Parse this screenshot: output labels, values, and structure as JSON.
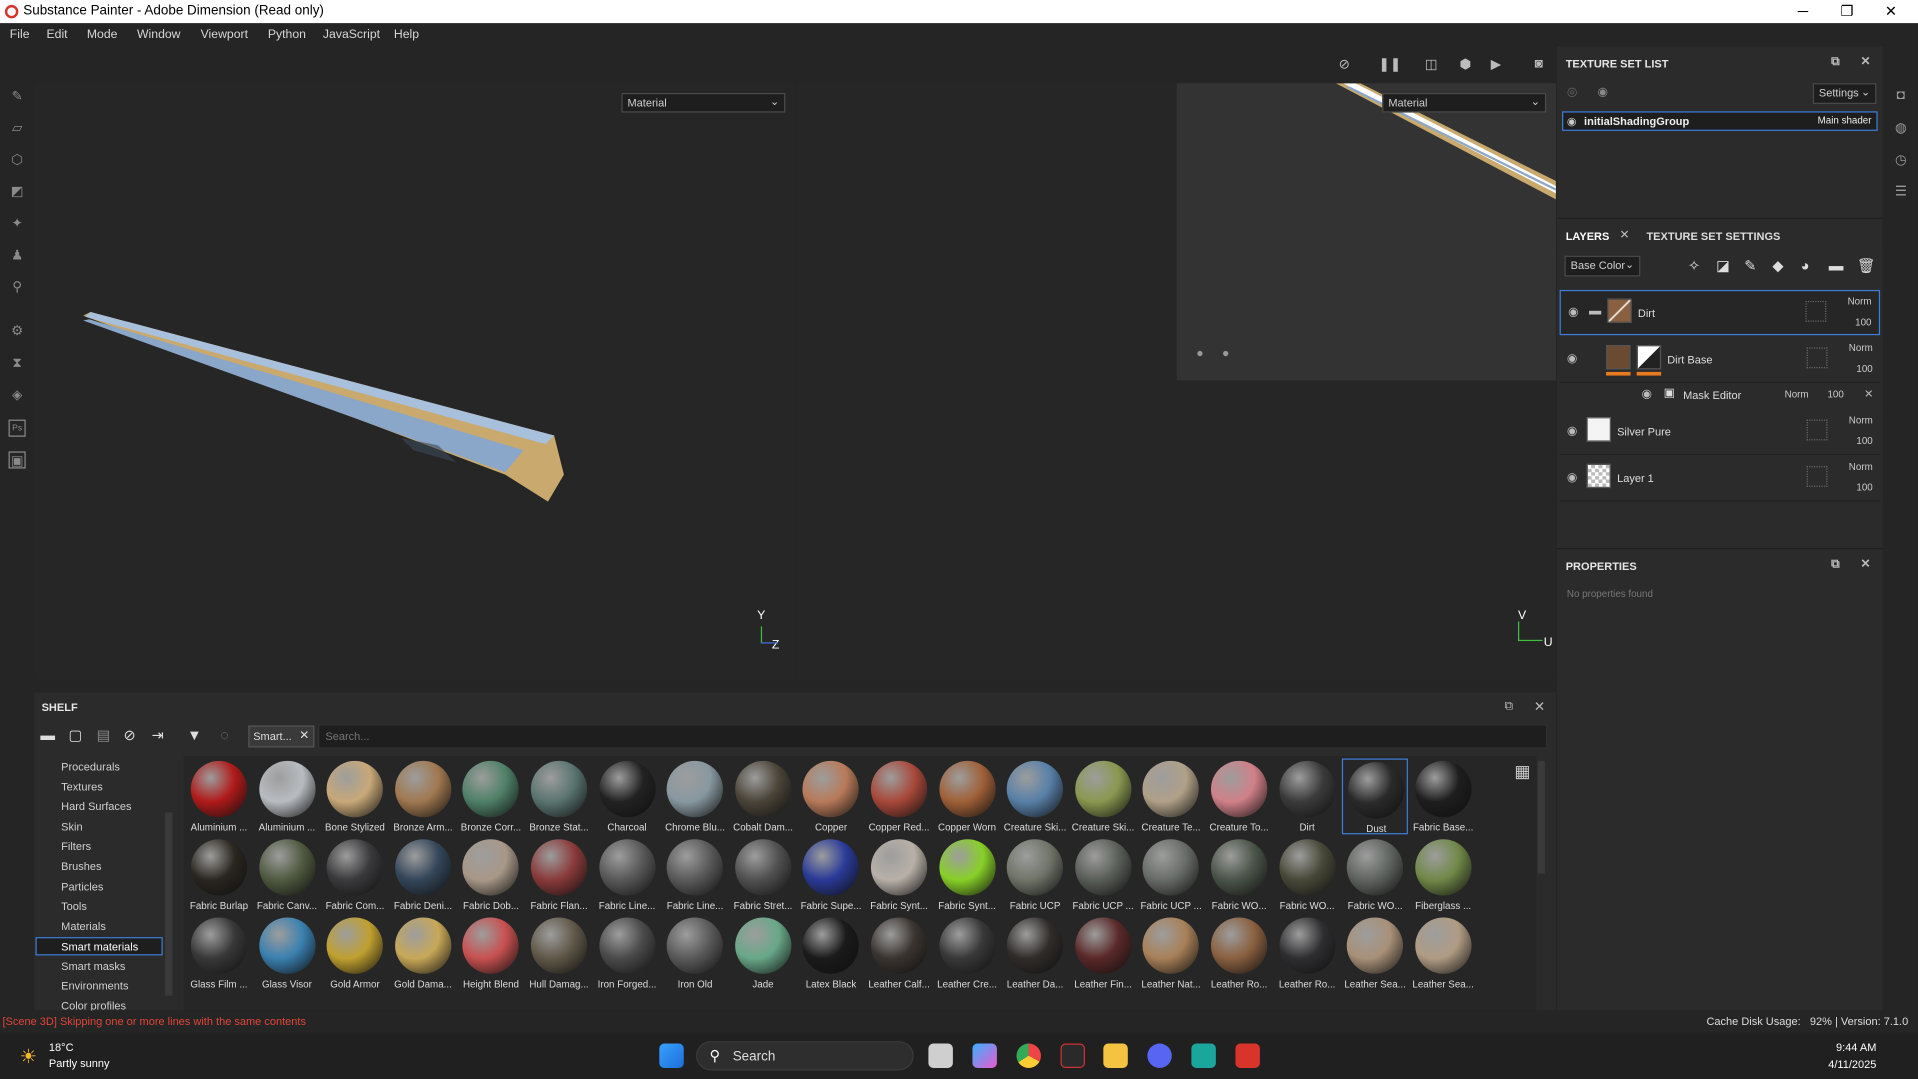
{
  "window": {
    "title": "Substance Painter - Adobe Dimension (Read only)",
    "minimize": "─",
    "maximize": "❐",
    "close": "✕"
  },
  "menu": [
    "File",
    "Edit",
    "Mode",
    "Window",
    "Viewport",
    "Python",
    "JavaScript",
    "Help"
  ],
  "viewport": {
    "left_dropdown": "Material",
    "right_dropdown": "Material",
    "axis_y": "Y",
    "axis_z": "Z",
    "axis_v": "V",
    "axis_u": "U"
  },
  "texture_set_list": {
    "title": "TEXTURE SET LIST",
    "settings_label": "Settings",
    "set_name": "initialShadingGroup",
    "shader": "Main shader"
  },
  "layers_panel": {
    "tab_layers": "LAYERS",
    "tab_tss": "TEXTURE SET SETTINGS",
    "channel": "Base Color",
    "layers": [
      {
        "name": "Dirt",
        "blend": "Norm",
        "opacity": "100"
      },
      {
        "name": "Dirt Base",
        "blend": "Norm",
        "opacity": "100"
      },
      {
        "name": "Mask Editor",
        "blend": "Norm",
        "opacity": "100"
      },
      {
        "name": "Silver Pure",
        "blend": "Norm",
        "opacity": "100"
      },
      {
        "name": "Layer 1",
        "blend": "Norm",
        "opacity": "100"
      }
    ]
  },
  "properties": {
    "title": "PROPERTIES",
    "empty": "No properties found"
  },
  "shelf": {
    "title": "SHELF",
    "filter_chip": "Smart...",
    "search_placeholder": "Search...",
    "categories": [
      "Procedurals",
      "Textures",
      "Hard Surfaces",
      "Skin",
      "Filters",
      "Brushes",
      "Particles",
      "Tools",
      "Materials",
      "Smart materials",
      "Smart masks",
      "Environments",
      "Color profiles"
    ],
    "selected_category": "Smart materials",
    "materials": [
      {
        "label": "Aluminium ...",
        "color": "#b01a1a"
      },
      {
        "label": "Aluminium ...",
        "color": "#b8bcc0"
      },
      {
        "label": "Bone Stylized",
        "color": "#c8a878"
      },
      {
        "label": "Bronze Arm...",
        "color": "#a07850"
      },
      {
        "label": "Bronze Corr...",
        "color": "#4f8068"
      },
      {
        "label": "Bronze Stat...",
        "color": "#5a7470"
      },
      {
        "label": "Charcoal",
        "color": "#222222"
      },
      {
        "label": "Chrome Blu...",
        "color": "#8898a0"
      },
      {
        "label": "Cobalt Dam...",
        "color": "#4a4438"
      },
      {
        "label": "Copper",
        "color": "#b87a5a"
      },
      {
        "label": "Copper Red...",
        "color": "#a8483a"
      },
      {
        "label": "Copper Worn",
        "color": "#a06038"
      },
      {
        "label": "Creature Ski...",
        "color": "#5880a8"
      },
      {
        "label": "Creature Ski...",
        "color": "#8a9850"
      },
      {
        "label": "Creature Te...",
        "color": "#b0a088"
      },
      {
        "label": "Creature To...",
        "color": "#d08088"
      },
      {
        "label": "Dirt",
        "color": "#3a3a3a"
      },
      {
        "label": "Dust",
        "color": "#2a2a2a"
      },
      {
        "label": "Fabric Base...",
        "color": "#1e1e1e"
      },
      {
        "label": "Fabric Burlap",
        "color": "#2a2620"
      },
      {
        "label": "Fabric Canv...",
        "color": "#505a40"
      },
      {
        "label": "Fabric Com...",
        "color": "#3a3a3c"
      },
      {
        "label": "Fabric Deni...",
        "color": "#34465a"
      },
      {
        "label": "Fabric Dob...",
        "color": "#a89888"
      },
      {
        "label": "Fabric Flan...",
        "color": "#8a3a3a"
      },
      {
        "label": "Fabric Line...",
        "color": "#585858"
      },
      {
        "label": "Fabric Line...",
        "color": "#5a5a5a"
      },
      {
        "label": "Fabric Stret...",
        "color": "#505050"
      },
      {
        "label": "Fabric Supe...",
        "color": "#2a3a98"
      },
      {
        "label": "Fabric Synt...",
        "color": "#b8b0a8"
      },
      {
        "label": "Fabric Synt...",
        "color": "#88d028"
      },
      {
        "label": "Fabric UCP",
        "color": "#707468"
      },
      {
        "label": "Fabric UCP ...",
        "color": "#5a5e58"
      },
      {
        "label": "Fabric UCP ...",
        "color": "#686c68"
      },
      {
        "label": "Fabric WO...",
        "color": "#4a5448"
      },
      {
        "label": "Fabric WO...",
        "color": "#484838"
      },
      {
        "label": "Fabric WO...",
        "color": "#606460"
      },
      {
        "label": "Fiberglass ...",
        "color": "#708848"
      },
      {
        "label": "Glass Film ...",
        "color": "#383838"
      },
      {
        "label": "Glass Visor",
        "color": "#3a80b0"
      },
      {
        "label": "Gold Armor",
        "color": "#c0a030"
      },
      {
        "label": "Gold Dama...",
        "color": "#c8a858"
      },
      {
        "label": "Height Blend",
        "color": "#c85050"
      },
      {
        "label": "Hull Damag...",
        "color": "#605848"
      },
      {
        "label": "Iron Forged...",
        "color": "#4a4a4a"
      },
      {
        "label": "Iron Old",
        "color": "#5a5a5a"
      },
      {
        "label": "Jade",
        "color": "#68a888"
      },
      {
        "label": "Latex Black",
        "color": "#1a1a1a"
      },
      {
        "label": "Leather Calf...",
        "color": "#3a3430"
      },
      {
        "label": "Leather Cre...",
        "color": "#383838"
      },
      {
        "label": "Leather Da...",
        "color": "#302c2a"
      },
      {
        "label": "Leather Fin...",
        "color": "#5a2828"
      },
      {
        "label": "Leather Nat...",
        "color": "#a88058"
      },
      {
        "label": "Leather Ro...",
        "color": "#8a6040"
      },
      {
        "label": "Leather Ro...",
        "color": "#2e2e30"
      },
      {
        "label": "Leather Sea...",
        "color": "#a89078"
      },
      {
        "label": "Leather Sea...",
        "color": "#b09c84"
      }
    ]
  },
  "status": {
    "message": "[Scene 3D] Skipping one or more lines with the same contents",
    "cache": "Cache Disk Usage:   92% | Version: 7.1.0"
  },
  "taskbar": {
    "temp": "18°C",
    "weather": "Partly sunny",
    "search": "Search",
    "time": "9:44 AM",
    "date": "4/11/2025"
  },
  "colors": {
    "accent": "#3d7ed8",
    "error_text": "#e0453a",
    "panel": "#2b2b2b"
  }
}
